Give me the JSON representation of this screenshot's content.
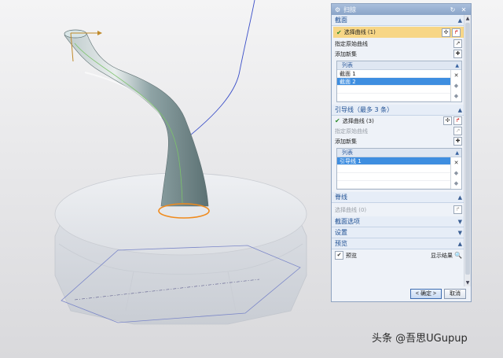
{
  "dialog": {
    "title": "扫掠",
    "reset_icon": "reset-icon",
    "close_icon": "close-icon",
    "section_curves": {
      "title": "截面",
      "select_curve": "选择曲线 (1)",
      "specify_origin": "指定原始曲线",
      "add_new_set": "添加新集",
      "list_title": "列表",
      "items": [
        "截面 1",
        "截面 2"
      ]
    },
    "section_guides": {
      "title": "引导线（最多 3 条）",
      "select_curve": "选择曲线 (3)",
      "specify_origin": "指定原始曲线",
      "add_new_set": "添加新集",
      "list_title": "列表",
      "items": [
        "引导线 1"
      ]
    },
    "section_spine": {
      "title": "脊线",
      "select_curve": "选择曲线 (0)"
    },
    "section_options": {
      "title": "截面选项"
    },
    "section_settings": {
      "title": "设置"
    },
    "section_preview": {
      "title": "预览",
      "preview_label": "预览",
      "preview_checked": true,
      "show_result": "显示结果"
    },
    "ok_label": "< 确定 >",
    "cancel_label": "取消"
  },
  "watermark": "头条 @吾思UGupup",
  "colors": {
    "titlebar": "#8aa4c8",
    "section_text": "#1e4f93",
    "highlight": "#f7d686",
    "selected": "#3e8ee0",
    "tube": "#7f9496",
    "nut": "#e6e8ec",
    "orange": "#f08a1c"
  }
}
